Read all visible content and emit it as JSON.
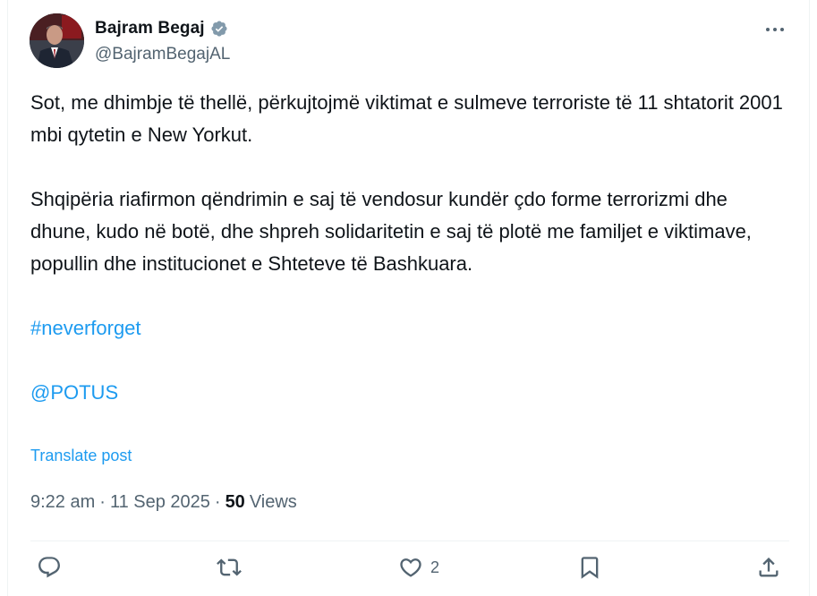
{
  "author": {
    "name": "Bajram Begaj",
    "handle": "@BajramBegajAL"
  },
  "post": {
    "paragraph1": "Sot, me dhimbje të thellë, përkujtojmë viktimat e sulmeve terroriste të 11 shtatorit 2001 mbi qytetin e New Yorkut.",
    "paragraph2": "Shqipëria riafirmon qëndrimin e saj të vendosur kundër çdo forme terrorizmi dhe dhune, kudo në botë, dhe shpreh solidaritetin e saj të plotë me familjet e viktimave, popullin dhe institucionet e Shteteve të Bashkuara.",
    "hashtag": "#neverforget",
    "mention": "@POTUS",
    "translate_label": "Translate post"
  },
  "meta": {
    "time": "9:22 am",
    "separator": "·",
    "date": "11 Sep 2025",
    "views_count": "50",
    "views_label": "Views"
  },
  "actions": {
    "likes_count": "2"
  },
  "icons": {
    "verified": "verified-badge-icon",
    "more": "more-dots-icon",
    "reply": "reply-icon",
    "repost": "repost-icon",
    "like": "heart-icon",
    "bookmark": "bookmark-icon",
    "share": "share-icon"
  },
  "colors": {
    "accent": "#1d9bf0",
    "secondary_text": "#536471",
    "primary_text": "#0f1419",
    "verified": "#829aab"
  }
}
